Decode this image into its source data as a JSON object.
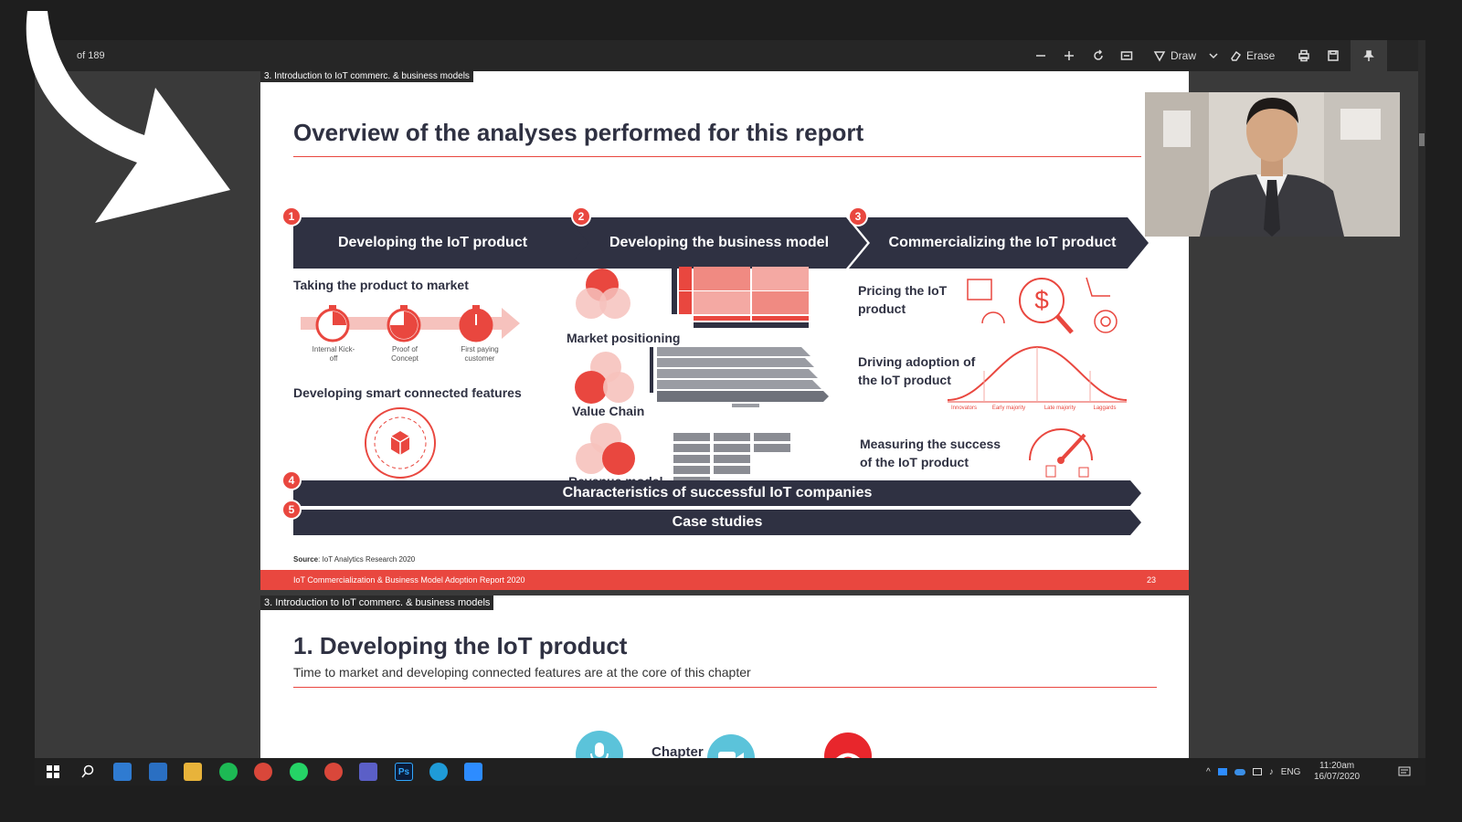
{
  "viewer": {
    "page_count": "of 189",
    "draw_label": "Draw",
    "erase_label": "Erase"
  },
  "slide1": {
    "section": "3. Introduction to IoT commerc. & business models",
    "title": "Overview of the analyses performed for this report",
    "steps": [
      {
        "num": "1",
        "label": "Developing the IoT product"
      },
      {
        "num": "2",
        "label": "Developing the business model"
      },
      {
        "num": "3",
        "label": "Commercializing the IoT product"
      }
    ],
    "col1": {
      "heading1": "Taking the product to market",
      "milestones": [
        "Internal Kick-off",
        "Proof of Concept",
        "First paying customer"
      ],
      "heading2": "Developing smart connected features"
    },
    "col2": {
      "labels": [
        "Market positioning",
        "Value Chain",
        "Revenue model"
      ]
    },
    "col3": {
      "labels": [
        "Pricing the IoT product",
        "Driving adoption of the IoT product",
        "Measuring the success of the IoT product"
      ],
      "adoption_stages": [
        "Innovators",
        "Early majority",
        "Late majority",
        "Laggards"
      ]
    },
    "bars": [
      {
        "num": "4",
        "label": "Characteristics of successful IoT companies"
      },
      {
        "num": "5",
        "label": "Case studies"
      }
    ],
    "source_label": "Source",
    "source_text": ": IoT Analytics Research 2020",
    "footer_left": "IoT Commercialization & Business Model Adoption Report 2020",
    "footer_page": "23"
  },
  "slide2": {
    "section": "3. Introduction to IoT commerc. & business models",
    "title": "1. Developing the IoT product",
    "subtitle": "Time to market and developing connected features are at the core of this chapter"
  },
  "overlay": {
    "chapter_text": "Chapter"
  },
  "taskbar": {
    "lang": "ENG",
    "time": "11:20am",
    "date": "16/07/2020",
    "apps": [
      "start-icon",
      "search-icon",
      "calendar-icon",
      "mail-icon",
      "file-explorer-icon",
      "spotify-icon",
      "chrome-icon",
      "whatsapp-icon",
      "chrome-profile-icon",
      "teams-icon",
      "photoshop-icon",
      "edge-icon",
      "zoom-icon"
    ],
    "ps_label": "Ps"
  },
  "colors": {
    "accent": "#e9473f",
    "navy": "#2f3142",
    "call_blue": "#5bc3da",
    "call_red": "#e8262c"
  }
}
